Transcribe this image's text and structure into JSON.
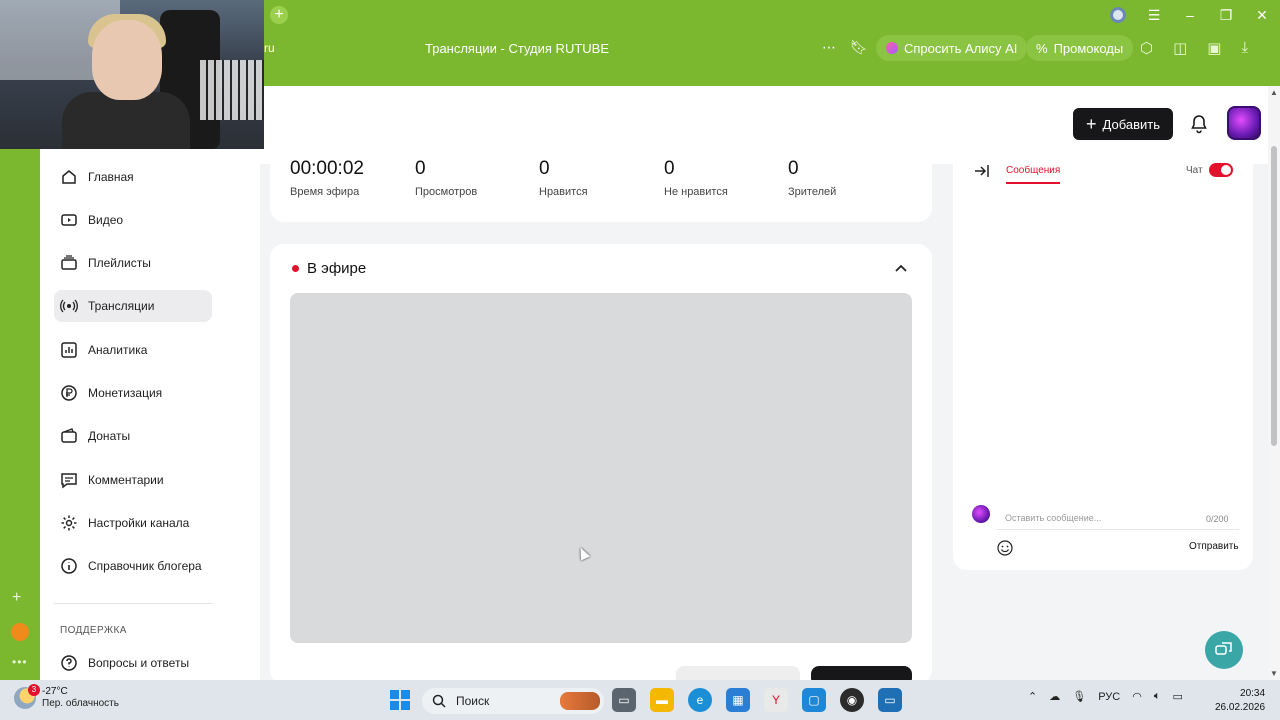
{
  "browser": {
    "page_title": "Трансляции - Студия RUTUBE",
    "url_fragment": "ru",
    "alice_label": "Спросить Алису AI",
    "promo_label": "Промокоды"
  },
  "header": {
    "add_label": "Добавить"
  },
  "sidebar": {
    "items": [
      {
        "label": "Главная",
        "icon": "home-icon"
      },
      {
        "label": "Видео",
        "icon": "video-icon"
      },
      {
        "label": "Плейлисты",
        "icon": "playlist-icon"
      },
      {
        "label": "Трансляции",
        "icon": "broadcast-icon"
      },
      {
        "label": "Аналитика",
        "icon": "analytics-icon"
      },
      {
        "label": "Монетизация",
        "icon": "ruble-icon"
      },
      {
        "label": "Донаты",
        "icon": "wallet-icon"
      },
      {
        "label": "Комментарии",
        "icon": "comment-icon"
      },
      {
        "label": "Настройки канала",
        "icon": "gear-icon"
      },
      {
        "label": "Справочник блогера",
        "icon": "info-icon"
      }
    ],
    "active": "Трансляции",
    "support_heading": "ПОДДЕРЖКА",
    "support_items": [
      {
        "label": "Вопросы и ответы",
        "icon": "question-icon"
      }
    ]
  },
  "stats": [
    {
      "value": "00:00:02",
      "label": "Время эфира"
    },
    {
      "value": "0",
      "label": "Просмотров"
    },
    {
      "value": "0",
      "label": "Нравится"
    },
    {
      "value": "0",
      "label": "Не нравится"
    },
    {
      "value": "0",
      "label": "Зрителей"
    }
  ],
  "live": {
    "title": "В эфире"
  },
  "chat": {
    "tab_messages": "Сообщения",
    "toggle_label": "Чат",
    "toggle_on": true,
    "input_placeholder": "Оставить сообщение...",
    "char_count": "0/200",
    "send_label": "Отправить"
  },
  "taskbar": {
    "temperature": "-27°C",
    "weather": "Пер. облачность",
    "weather_badge": "3",
    "search_label": "Поиск",
    "language": "РУС",
    "time": "20:34",
    "date": "26.02.2026"
  },
  "colors": {
    "browser_green": "#7cb82f",
    "accent_red": "#e3112b",
    "dark_button": "#17171a"
  }
}
